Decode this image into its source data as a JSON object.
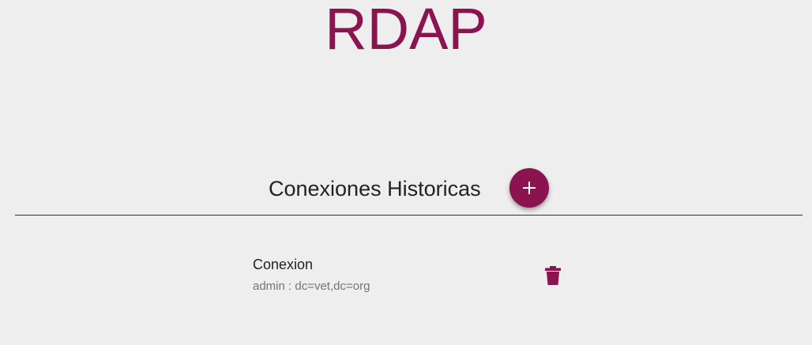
{
  "app": {
    "title": "RDAP"
  },
  "section": {
    "title": "Conexiones Historicas",
    "add_icon": "plus-icon"
  },
  "connections": [
    {
      "title": "Conexion",
      "subtitle": "admin : dc=vet,dc=org",
      "action_icon": "trash-icon"
    }
  ],
  "colors": {
    "accent": "#8b1350",
    "background": "#eeeeee",
    "text_primary": "#222222",
    "text_secondary": "#757575"
  }
}
